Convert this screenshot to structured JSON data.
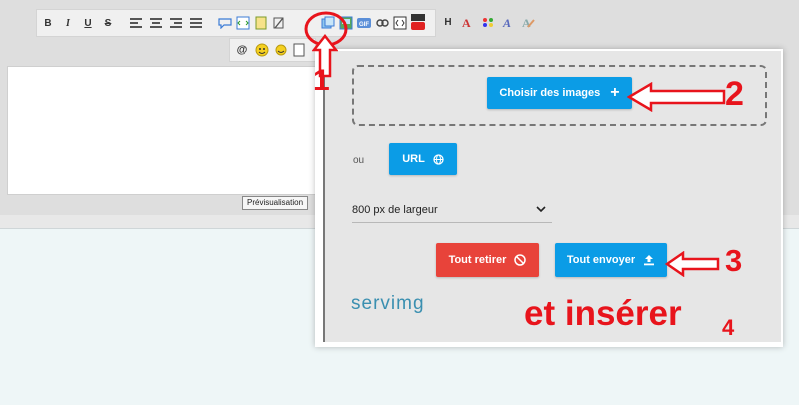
{
  "toolbar": {
    "bold": "B",
    "italic": "I",
    "underline": "U",
    "strike": "S",
    "h_button": "H",
    "at_button": "@"
  },
  "editor": {
    "preview_label": "Prévisualisation"
  },
  "upload": {
    "choose_images_label": "Choisir des images",
    "or_label": "ou",
    "url_label": "URL",
    "width_select_value": "800 px de largeur",
    "remove_all_label": "Tout retirer",
    "send_all_label": "Tout envoyer",
    "brand": "servimg"
  },
  "annotations": {
    "step1": "1",
    "step2": "2",
    "step3": "3",
    "step4_text": "et insérer",
    "step4_num": "4"
  },
  "colors": {
    "accent_blue": "#0b9ce6",
    "danger_red": "#e8433a",
    "annotation_red": "#e8141c",
    "brand_teal": "#3a8fb0"
  }
}
